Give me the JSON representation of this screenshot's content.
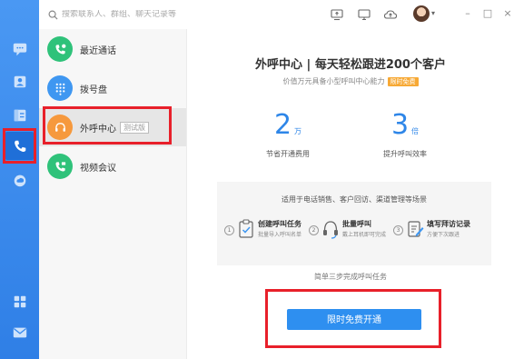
{
  "search": {
    "placeholder": "搜索联系人、群组、聊天记录等"
  },
  "topbar": {
    "icons": [
      "screen-share-icon",
      "monitor-icon",
      "cloud-upload-icon"
    ],
    "window": [
      "–",
      "□",
      "×"
    ]
  },
  "rail": {
    "items": [
      "chat-icon",
      "contacts-icon",
      "calendar-icon",
      "phone-icon",
      "cloud-icon",
      "apps-icon",
      "mail-icon"
    ]
  },
  "list": {
    "items": [
      {
        "label": "最近通话",
        "color": "#2fc27a"
      },
      {
        "label": "拨号盘",
        "color": "#3f97f1"
      },
      {
        "label": "外呼中心",
        "color": "#f6993d",
        "badge": "测试版"
      },
      {
        "label": "视频会议",
        "color": "#2fc27a"
      }
    ]
  },
  "main": {
    "title": "外呼中心 | 每天轻松跟进200个客户",
    "subtitle": "价值万元具备小型呼叫中心能力",
    "tag": "限时免费",
    "stats": [
      {
        "num": "2",
        "unit": "万",
        "caption": "节省开通费用"
      },
      {
        "num": "3",
        "unit": "倍",
        "caption": "提升呼叫效率"
      }
    ],
    "card_head": "适用于电话销售、客户回访、渠道管理等场景",
    "steps": [
      {
        "n": "1",
        "title": "创建呼叫任务",
        "desc": "批量导入呼叫名单"
      },
      {
        "n": "2",
        "title": "批量呼叫",
        "desc": "戴上耳机即可完成"
      },
      {
        "n": "3",
        "title": "填写拜访记录",
        "desc": "方便下次跟进"
      }
    ],
    "hint": "简单三步完成呼叫任务",
    "cta": "限时免费开通"
  },
  "colors": {
    "accent": "#2e8ff0",
    "highlight": "#e8202a",
    "rail": "#3a8cf0"
  }
}
